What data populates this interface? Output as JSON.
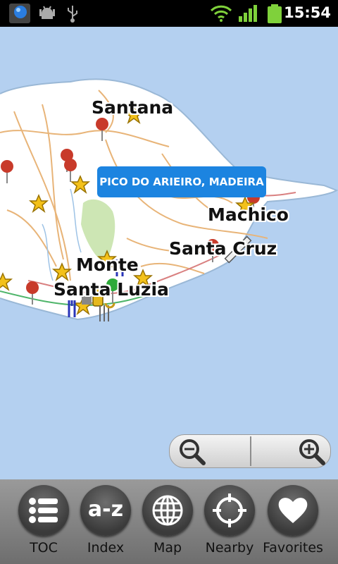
{
  "status_bar": {
    "time": "15:54",
    "icons": [
      "app-notification-icon",
      "android-debug-icon",
      "usb-icon",
      "wifi-icon",
      "signal-icon",
      "battery-icon"
    ]
  },
  "map": {
    "callout": "PICO DO ARIEIRO, MADEIRA",
    "place_labels": {
      "santana": "Santana",
      "machico": "Machico",
      "santa_cruz": "Santa Cruz",
      "monte": "Monte",
      "santa_luzia": "Santa Luzia"
    },
    "colors": {
      "sea": "#b4d0f0",
      "land": "#ffffff",
      "park": "#cde6b4",
      "callout": "#1c84e0"
    }
  },
  "zoom": {
    "out_icon": "zoom-out-icon",
    "in_icon": "zoom-in-icon"
  },
  "toolbar": {
    "items": [
      {
        "label": "TOC",
        "icon": "list-icon"
      },
      {
        "label": "Index",
        "icon": "a-z-icon"
      },
      {
        "label": "Map",
        "icon": "globe-icon"
      },
      {
        "label": "Nearby",
        "icon": "crosshair-icon"
      },
      {
        "label": "Favorites",
        "icon": "heart-icon"
      }
    ],
    "index_icon_text": "a-z"
  }
}
